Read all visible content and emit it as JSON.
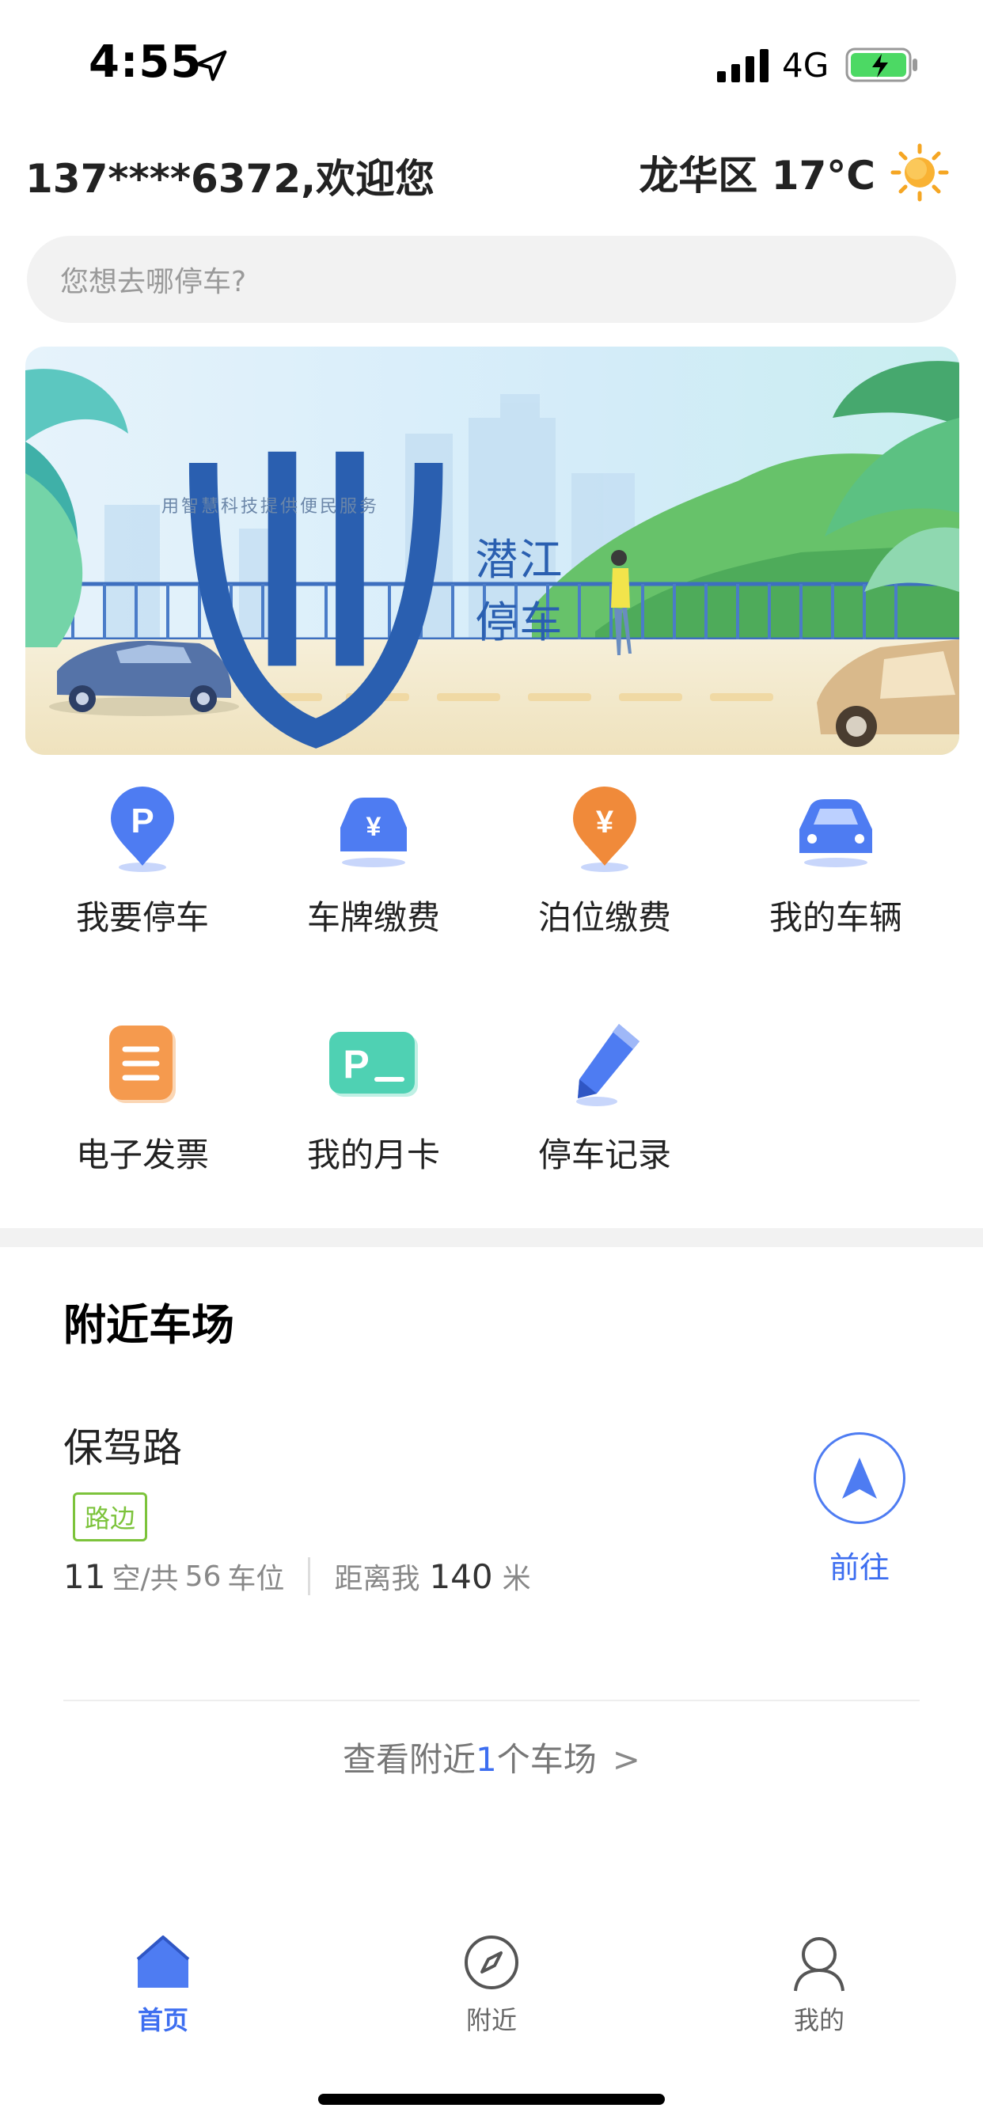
{
  "status_bar": {
    "time": "4:55",
    "network": "4G"
  },
  "header": {
    "welcome": "137****6372,欢迎您",
    "weather": "龙华区 17°C"
  },
  "search": {
    "placeholder": "您想去哪停车?"
  },
  "banner": {
    "brand": "潜江停车",
    "slogan": "用智慧科技提供便民服务"
  },
  "menu": {
    "items": [
      {
        "label": "我要停车",
        "icon": "parking-pin-icon"
      },
      {
        "label": "车牌缴费",
        "icon": "plate-payment-icon"
      },
      {
        "label": "泊位缴费",
        "icon": "berth-payment-icon"
      },
      {
        "label": "我的车辆",
        "icon": "car-icon"
      },
      {
        "label": "电子发票",
        "icon": "invoice-icon"
      },
      {
        "label": "我的月卡",
        "icon": "monthly-card-icon"
      },
      {
        "label": "停车记录",
        "icon": "pencil-record-icon"
      }
    ]
  },
  "nearby": {
    "title": "附近车场",
    "lot": {
      "name": "保驾路",
      "tag": "路边",
      "free": "11",
      "free_label": "空",
      "total_prefix": "/共",
      "total": "56",
      "total_label": "车位",
      "distance_label": "距离我",
      "distance": "140",
      "distance_unit": "米",
      "go_label": "前往"
    },
    "more": {
      "prefix": "查看附近",
      "count": "1",
      "suffix": "个车场",
      "chevron": ">"
    }
  },
  "tabbar": {
    "items": [
      {
        "label": "首页",
        "active": true
      },
      {
        "label": "附近",
        "active": false
      },
      {
        "label": "我的",
        "active": false
      }
    ]
  },
  "colors": {
    "accent": "#3d6ef0",
    "tag_green": "#7cc33b",
    "search_bg": "#f2f2f2"
  }
}
